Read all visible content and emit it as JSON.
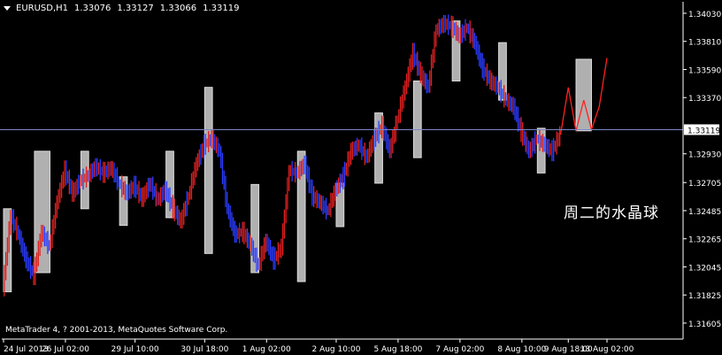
{
  "header": {
    "symbol": "EURUSD,H1",
    "open": "1.33076",
    "high": "1.33127",
    "low": "1.33066",
    "close": "1.33119"
  },
  "copyright": "MetaTrader 4, ? 2001-2013, MetaQuotes Software Corp.",
  "overlay_text": "周二的水晶球",
  "colors": {
    "background": "#000000",
    "axis": "#ffffff",
    "bull": "#e02020",
    "bear": "#2a3cff",
    "box": "#b0b0b0",
    "price_line": "#7b86c9",
    "forecast": "#ff2020"
  },
  "chart_data": {
    "type": "line",
    "ylim": [
      1.3148,
      1.3412
    ],
    "y_ticks": [
      "1.34030",
      "1.33810",
      "1.33590",
      "1.33370",
      "1.33119",
      "1.32930",
      "1.32705",
      "1.32485",
      "1.32265",
      "1.32045",
      "1.31825",
      "1.31605"
    ],
    "current_price": "1.33119",
    "x_ticks": [
      "24 Jul 2013",
      "26 Jul 02:00",
      "29 Jul 10:00",
      "30 Jul 18:00",
      "1 Aug 02:00",
      "2 Aug 10:00",
      "5 Aug 18:00",
      "7 Aug 02:00",
      "8 Aug 10:00",
      "9 Aug 18:00",
      "13 Aug 02:00"
    ],
    "path_points": [
      [
        0,
        1.3188
      ],
      [
        1,
        1.3245
      ],
      [
        2,
        1.323
      ],
      [
        3,
        1.321
      ],
      [
        4,
        1.3198
      ],
      [
        5,
        1.3232
      ],
      [
        6,
        1.322
      ],
      [
        7,
        1.3255
      ],
      [
        8,
        1.328
      ],
      [
        9,
        1.3262
      ],
      [
        10,
        1.3272
      ],
      [
        11,
        1.3276
      ],
      [
        12,
        1.3283
      ],
      [
        13,
        1.3278
      ],
      [
        14,
        1.3282
      ],
      [
        15,
        1.327
      ],
      [
        16,
        1.3262
      ],
      [
        17,
        1.3268
      ],
      [
        18,
        1.3258
      ],
      [
        19,
        1.327
      ],
      [
        20,
        1.3257
      ],
      [
        21,
        1.3265
      ],
      [
        22,
        1.325
      ],
      [
        23,
        1.324
      ],
      [
        24,
        1.326
      ],
      [
        25,
        1.3285
      ],
      [
        26,
        1.33
      ],
      [
        27,
        1.3305
      ],
      [
        28,
        1.3295
      ],
      [
        29,
        1.325
      ],
      [
        30,
        1.323
      ],
      [
        31,
        1.3232
      ],
      [
        32,
        1.3222
      ],
      [
        33,
        1.3205
      ],
      [
        34,
        1.3225
      ],
      [
        35,
        1.321
      ],
      [
        36,
        1.322
      ],
      [
        37,
        1.328
      ],
      [
        38,
        1.3278
      ],
      [
        39,
        1.3285
      ],
      [
        40,
        1.326
      ],
      [
        41,
        1.3255
      ],
      [
        42,
        1.3248
      ],
      [
        43,
        1.3265
      ],
      [
        44,
        1.3275
      ],
      [
        45,
        1.3295
      ],
      [
        46,
        1.33
      ],
      [
        47,
        1.329
      ],
      [
        48,
        1.3305
      ],
      [
        49,
        1.3315
      ],
      [
        50,
        1.3295
      ],
      [
        51,
        1.332
      ],
      [
        52,
        1.3345
      ],
      [
        53,
        1.3372
      ],
      [
        54,
        1.3355
      ],
      [
        55,
        1.3345
      ],
      [
        56,
        1.339
      ],
      [
        57,
        1.3395
      ],
      [
        58,
        1.3393
      ],
      [
        59,
        1.3385
      ],
      [
        60,
        1.3392
      ],
      [
        61,
        1.338
      ],
      [
        62,
        1.336
      ],
      [
        63,
        1.335
      ],
      [
        64,
        1.3345
      ],
      [
        65,
        1.3335
      ],
      [
        66,
        1.333
      ],
      [
        67,
        1.331
      ],
      [
        68,
        1.3295
      ],
      [
        69,
        1.3305
      ],
      [
        70,
        1.33
      ],
      [
        71,
        1.3295
      ],
      [
        72,
        1.3308
      ]
    ],
    "forecast_points": [
      [
        72,
        1.3308
      ],
      [
        73,
        1.3345
      ],
      [
        74,
        1.3311
      ],
      [
        75,
        1.3335
      ],
      [
        76,
        1.3312
      ],
      [
        77,
        1.333
      ],
      [
        78,
        1.3368
      ]
    ],
    "session_boxes": [
      {
        "x": [
          0,
          1
        ],
        "y": [
          1.3185,
          1.325
        ]
      },
      {
        "x": [
          4,
          6
        ],
        "y": [
          1.32,
          1.3295
        ]
      },
      {
        "x": [
          10,
          11
        ],
        "y": [
          1.325,
          1.3295
        ]
      },
      {
        "x": [
          15,
          16
        ],
        "y": [
          1.3237,
          1.3275
        ]
      },
      {
        "x": [
          21,
          22
        ],
        "y": [
          1.3243,
          1.3295
        ]
      },
      {
        "x": [
          26,
          27
        ],
        "y": [
          1.3215,
          1.3345
        ]
      },
      {
        "x": [
          32,
          33
        ],
        "y": [
          1.32,
          1.3269
        ]
      },
      {
        "x": [
          38,
          39
        ],
        "y": [
          1.3193,
          1.3295
        ]
      },
      {
        "x": [
          43,
          44
        ],
        "y": [
          1.3236,
          1.327
        ]
      },
      {
        "x": [
          48,
          49
        ],
        "y": [
          1.327,
          1.3325
        ]
      },
      {
        "x": [
          53,
          54
        ],
        "y": [
          1.329,
          1.335
        ]
      },
      {
        "x": [
          58,
          59
        ],
        "y": [
          1.335,
          1.3397
        ]
      },
      {
        "x": [
          64,
          65
        ],
        "y": [
          1.3335,
          1.338
        ]
      },
      {
        "x": [
          69,
          70
        ],
        "y": [
          1.3278,
          1.3313
        ]
      },
      {
        "x": [
          74,
          76
        ],
        "y": [
          1.3311,
          1.3367
        ]
      }
    ]
  }
}
